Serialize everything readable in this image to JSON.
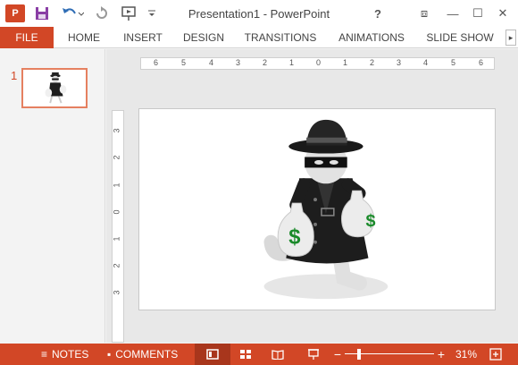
{
  "window": {
    "title": "Presentation1 - PowerPoint",
    "app_logo_text": "P",
    "controls": {
      "help": "?",
      "ribbon_display": "⧈",
      "minimize": "—",
      "maximize": "☐",
      "close": "✕"
    }
  },
  "quick_access": [
    "save-icon",
    "undo-icon",
    "redo-icon",
    "start-from-beginning-icon",
    "customize-toolbar-icon"
  ],
  "ribbon": {
    "tabs": [
      "FILE",
      "HOME",
      "INSERT",
      "DESIGN",
      "TRANSITIONS",
      "ANIMATIONS",
      "SLIDE SHOW"
    ],
    "scroll": "▸"
  },
  "thumbnails": [
    {
      "number": "1",
      "selected": true,
      "image": "masked-thief-with-money-bags"
    }
  ],
  "rulers": {
    "horizontal": [
      "6",
      "5",
      "4",
      "3",
      "2",
      "1",
      "0",
      "1",
      "2",
      "3",
      "4",
      "5",
      "6"
    ],
    "vertical": [
      "3",
      "2",
      "1",
      "0",
      "1",
      "2",
      "3"
    ]
  },
  "slide": {
    "image": "masked-thief-with-money-bags",
    "bag_symbol": "$"
  },
  "statusbar": {
    "notes_label": "NOTES",
    "comments_label": "COMMENTS",
    "zoom_minus": "−",
    "zoom_plus": "+",
    "zoom_level": "31%",
    "zoom_fraction": 0.31
  },
  "colors": {
    "accent": "#d24726",
    "status_active": "#a8361c",
    "thumb_border": "#e58060",
    "money_green": "#1a8a2a"
  }
}
